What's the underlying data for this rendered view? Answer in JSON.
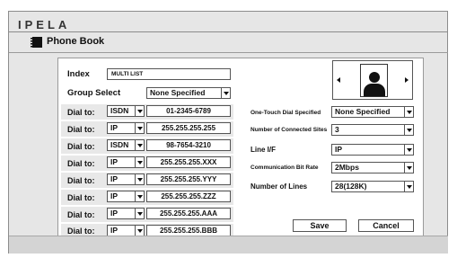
{
  "brand": "IPELA",
  "title": "Phone Book",
  "index": {
    "label": "Index",
    "value": "MULTI LIST"
  },
  "group_select": {
    "label": "Group Select",
    "value": "None Specified"
  },
  "dial_label": "Dial to:",
  "dial_rows": [
    {
      "type": "ISDN",
      "number": "01-2345-6789"
    },
    {
      "type": "IP",
      "number": "255.255.255.255"
    },
    {
      "type": "ISDN",
      "number": "98-7654-3210"
    },
    {
      "type": "IP",
      "number": "255.255.255.XXX"
    },
    {
      "type": "IP",
      "number": "255.255.255.YYY"
    },
    {
      "type": "IP",
      "number": "255.255.255.ZZZ"
    },
    {
      "type": "IP",
      "number": "255.255.255.AAA"
    },
    {
      "type": "IP",
      "number": "255.255.255.BBB"
    }
  ],
  "one_touch": {
    "label": "One-Touch Dial Specified",
    "value": "None Specified"
  },
  "connected_sites": {
    "label": "Number of Connected Sites",
    "value": "3"
  },
  "line_if": {
    "label": "Line I/F",
    "value": "IP"
  },
  "bit_rate": {
    "label": "Communication Bit Rate",
    "value": "2Mbps"
  },
  "num_lines": {
    "label": "Number of Lines",
    "value": "28(128K)"
  },
  "buttons": {
    "save": "Save",
    "cancel": "Cancel"
  }
}
